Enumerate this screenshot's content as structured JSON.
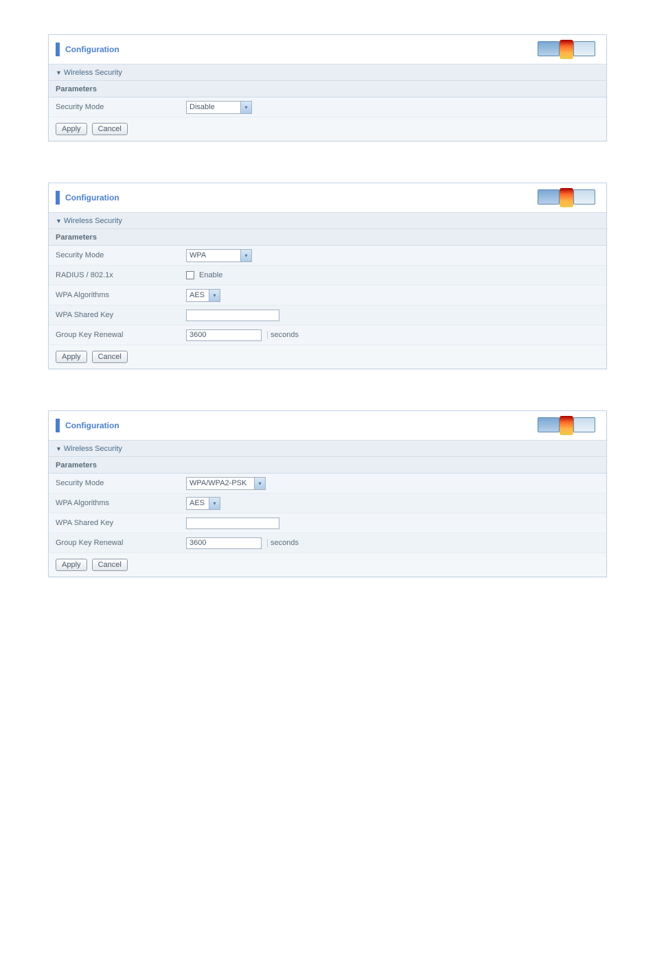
{
  "panel1": {
    "title": "Configuration",
    "section_title": "Wireless Security",
    "params_header": "Parameters",
    "security_mode_label": "Security Mode",
    "security_mode_value": "Disable",
    "apply_label": "Apply",
    "cancel_label": "Cancel"
  },
  "panel2": {
    "title": "Configuration",
    "section_title": "Wireless Security",
    "params_header": "Parameters",
    "security_mode_label": "Security Mode",
    "security_mode_value": "WPA",
    "radius_label": "RADIUS / 802.1x",
    "radius_enable_label": "Enable",
    "wpa_alg_label": "WPA Algorithms",
    "wpa_alg_value": "AES",
    "wpa_key_label": "WPA Shared Key",
    "wpa_key_value": "",
    "group_key_label": "Group Key Renewal",
    "group_key_value": "3600",
    "group_key_unit": "seconds",
    "apply_label": "Apply",
    "cancel_label": "Cancel"
  },
  "panel3": {
    "title": "Configuration",
    "section_title": "Wireless Security",
    "params_header": "Parameters",
    "security_mode_label": "Security Mode",
    "security_mode_value": "WPA/WPA2-PSK",
    "wpa_alg_label": "WPA Algorithms",
    "wpa_alg_value": "AES",
    "wpa_key_label": "WPA Shared Key",
    "wpa_key_value": "",
    "group_key_label": "Group Key Renewal",
    "group_key_value": "3600",
    "group_key_unit": "seconds",
    "apply_label": "Apply",
    "cancel_label": "Cancel"
  }
}
